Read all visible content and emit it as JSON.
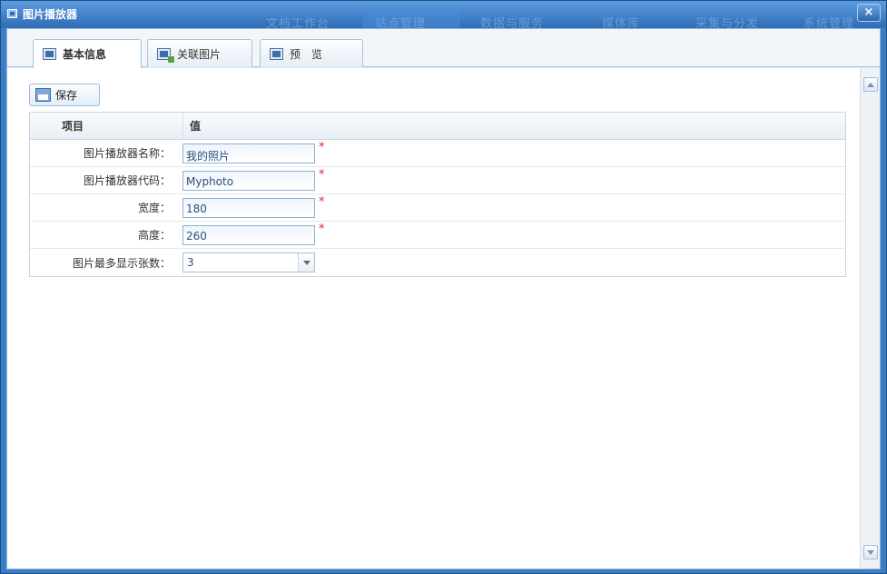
{
  "window": {
    "title": "图片播放器",
    "close_label": "×"
  },
  "background_nav": [
    "文档工作台",
    "站点管理",
    "数据与服务",
    "媒体库",
    "采集与分发",
    "系统管理"
  ],
  "tabs": [
    {
      "label": "基本信息",
      "icon": "form-icon"
    },
    {
      "label": "关联图片",
      "icon": "image-link-icon"
    },
    {
      "label": "预　览",
      "icon": "preview-icon"
    }
  ],
  "toolbar": {
    "save_label": "保存"
  },
  "grid": {
    "col_item": "项目",
    "col_value": "值",
    "rows": [
      {
        "label": "图片播放器名称：",
        "value": "我的照片",
        "required": "*"
      },
      {
        "label": "图片播放器代码：",
        "value": "Myphoto",
        "required": "*"
      },
      {
        "label": "宽度：",
        "value": "180",
        "required": "*"
      },
      {
        "label": "高度：",
        "value": "260",
        "required": "*"
      },
      {
        "label": "图片最多显示张数：",
        "value": "3"
      }
    ]
  }
}
